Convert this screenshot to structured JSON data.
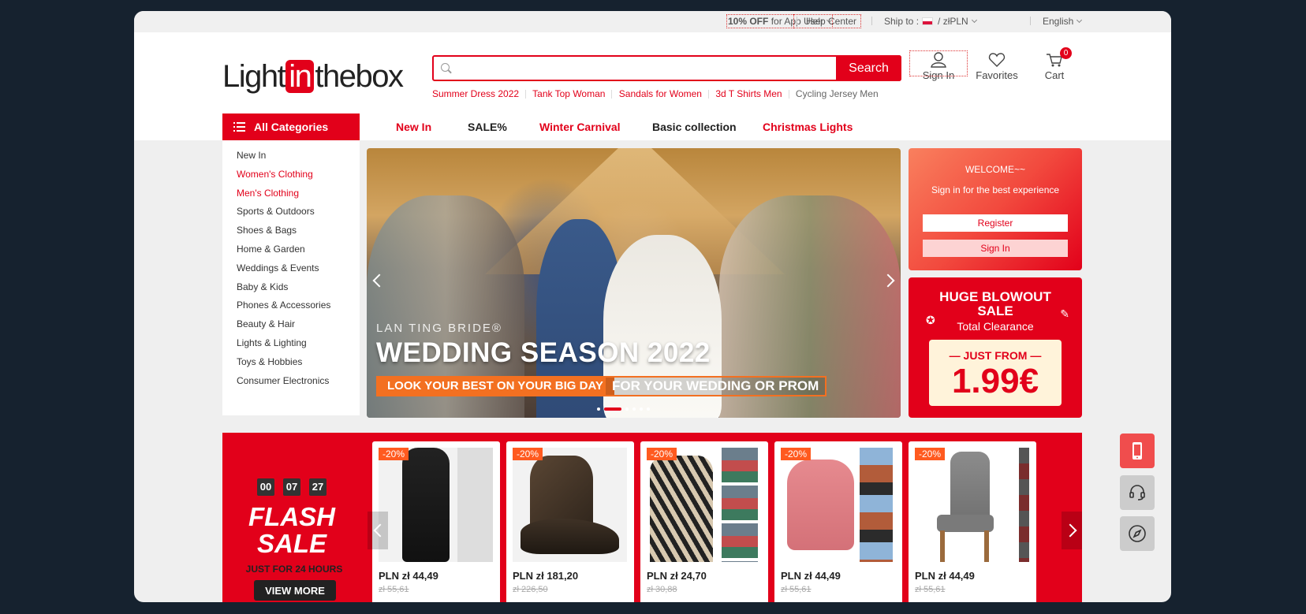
{
  "topbar": {
    "promo_strong": "10% OFF",
    "promo_rest": " for App User",
    "help": "Help Center",
    "ship_label": "Ship to :",
    "currency": "/ złPLN",
    "language": "English"
  },
  "header": {
    "logo_pre": "Light",
    "logo_in": "in",
    "logo_post": "thebox",
    "search_placeholder": "",
    "search_button": "Search",
    "hotwords": [
      "Summer Dress 2022",
      "Tank Top Woman",
      "Sandals for Women",
      "3d T Shirts Men",
      "Cycling Jersey Men"
    ],
    "sign_in": "Sign In",
    "favorites": "Favorites",
    "cart": "Cart",
    "cart_count": "0"
  },
  "nav": {
    "all_categories": "All Categories",
    "links": [
      {
        "label": "New In",
        "color": "#e2001a"
      },
      {
        "label": "SALE%",
        "color": "#222222"
      },
      {
        "label": "Winter Carnival",
        "color": "#e2001a"
      },
      {
        "label": "Basic collection",
        "color": "#222222"
      },
      {
        "label": "Christmas Lights",
        "color": "#e2001a"
      }
    ]
  },
  "categories": [
    "New In",
    "Women's Clothing",
    "Men's Clothing",
    "Sports & Outdoors",
    "Shoes & Bags",
    "Home & Garden",
    "Weddings & Events",
    "Baby & Kids",
    "Phones & Accessories",
    "Beauty & Hair",
    "Lights & Lighting",
    "Toys & Hobbies",
    "Consumer Electronics"
  ],
  "banner": {
    "brand": "LAN TING BRIDE®",
    "headline": "WEDDING SEASON 2022",
    "tag1": "LOOK YOUR BEST ON YOUR BIG DAY",
    "tag2": "FOR YOUR WEDDING OR PROM"
  },
  "welcome": {
    "title": "WELCOME~~",
    "subtitle": "Sign in for the best experience",
    "register": "Register",
    "sign_in": "Sign In"
  },
  "sale": {
    "title": "HUGE BLOWOUT SALE",
    "subtitle": "Total Clearance",
    "from": "— JUST FROM —",
    "price": "1.99€"
  },
  "flash": {
    "timer": [
      "00",
      "07",
      "27"
    ],
    "title": "FLASH SALE",
    "subtitle": "JUST FOR 24 HOURS",
    "view_more": "VIEW MORE",
    "products": [
      {
        "off": "-20%",
        "price": "PLN zł 44,49",
        "old": "zł 55,61"
      },
      {
        "off": "-20%",
        "price": "PLN zł 181,20",
        "old": "zł 226,50"
      },
      {
        "off": "-20%",
        "price": "PLN zł 24,70",
        "old": "zł 30,88"
      },
      {
        "off": "-20%",
        "price": "PLN zł 44,49",
        "old": "zł 55,61"
      },
      {
        "off": "-20%",
        "price": "PLN zł 44,49",
        "old": "zł 55,61"
      }
    ]
  },
  "colors": {
    "brand": "#e2001a",
    "accent": "#f37021"
  }
}
